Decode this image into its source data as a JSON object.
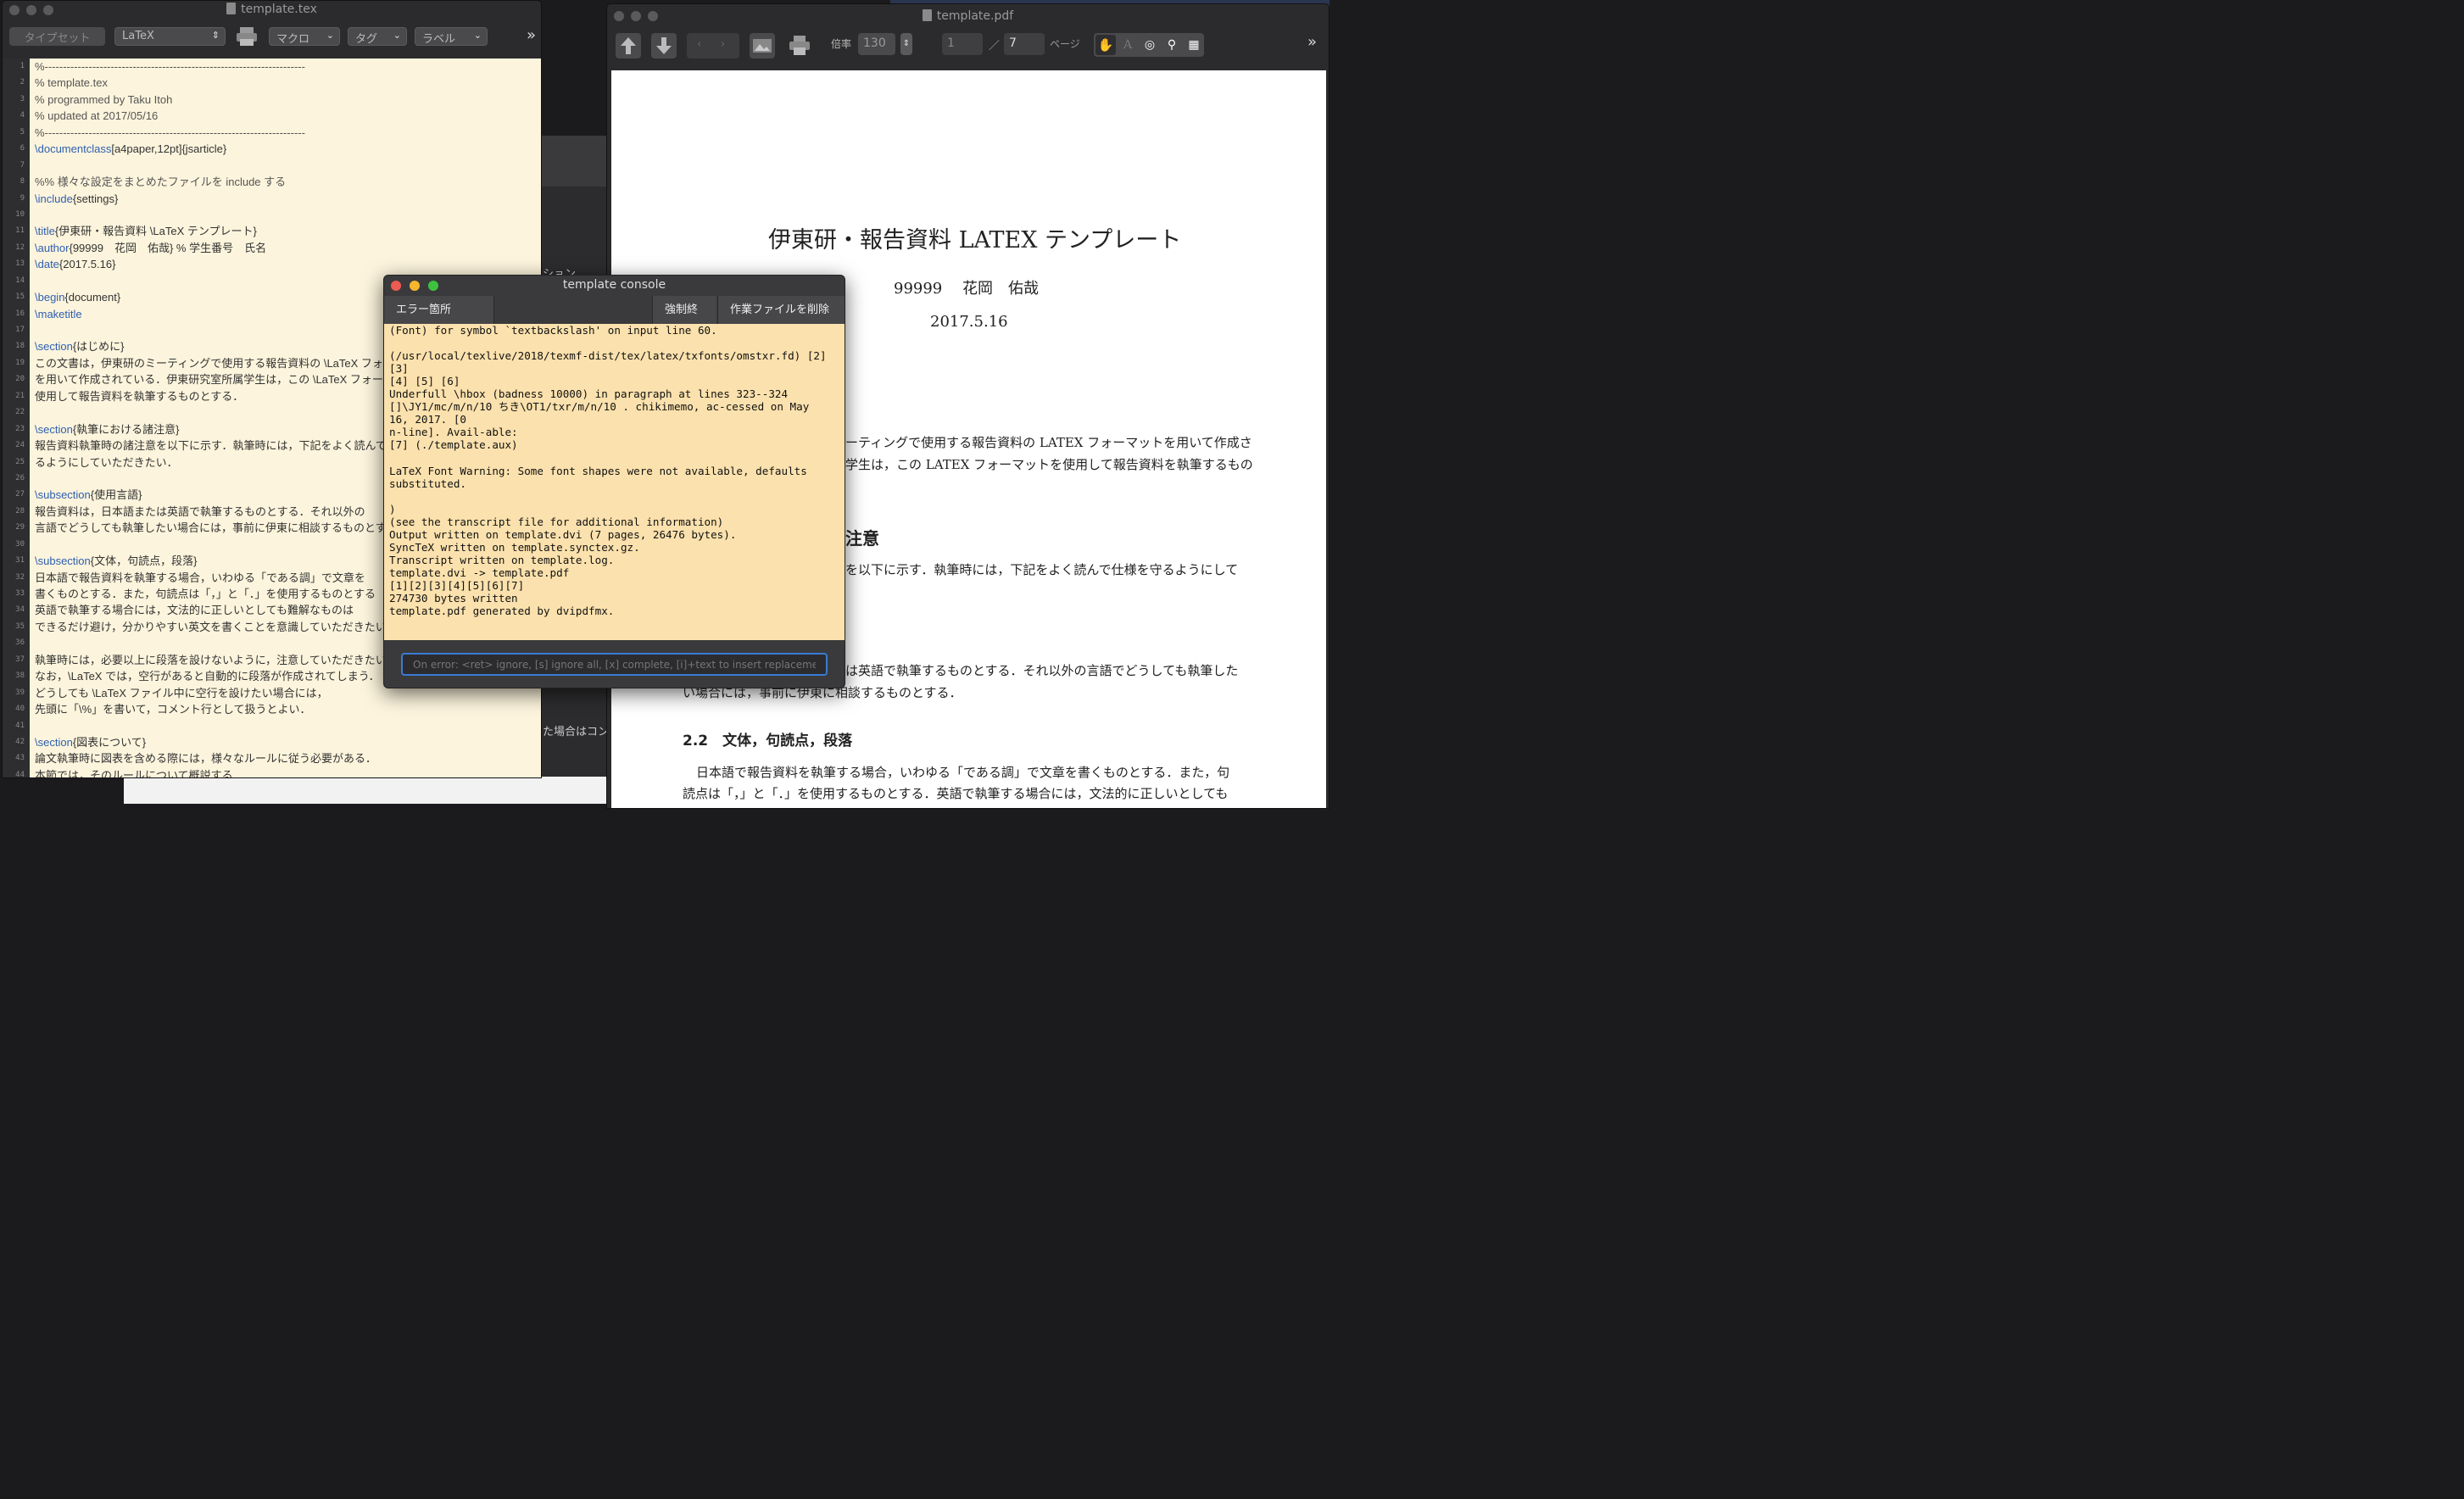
{
  "editor": {
    "title": "template.tex",
    "toolbar": {
      "typeset": "タイプセット",
      "engine": "LaTeX",
      "macro": "マクロ",
      "tag": "タグ",
      "label": "ラベル",
      "more": "»"
    },
    "lines": [
      {
        "n": "1",
        "t": "%-----------------------------------------------------------------------"
      },
      {
        "n": "2",
        "t": "%                 template.tex"
      },
      {
        "n": "3",
        "t": "%                 programmed  by Taku Itoh"
      },
      {
        "n": "4",
        "t": "%                 updated     at 2017/05/16"
      },
      {
        "n": "5",
        "t": "%-----------------------------------------------------------------------"
      },
      {
        "n": "6",
        "c": "\\documentclass",
        "t": "[a4paper,12pt]{jsarticle}"
      },
      {
        "n": "7",
        "t": ""
      },
      {
        "n": "8",
        "t": "%% 様々な設定をまとめたファイルを include する"
      },
      {
        "n": "9",
        "c": "\\include",
        "t": "{settings}"
      },
      {
        "n": "10",
        "t": ""
      },
      {
        "n": "11",
        "c": "\\title",
        "t": "{伊東研・報告資料 \\LaTeX テンプレート}"
      },
      {
        "n": "12",
        "c": "\\author",
        "t": "{99999　花岡　佑哉} % 学生番号　氏名"
      },
      {
        "n": "13",
        "c": "\\date",
        "t": "{2017.5.16}"
      },
      {
        "n": "14",
        "t": ""
      },
      {
        "n": "15",
        "c": "\\begin",
        "t": "{document}"
      },
      {
        "n": "16",
        "c": "\\maketitle",
        "t": ""
      },
      {
        "n": "17",
        "t": ""
      },
      {
        "n": "18",
        "c": "\\section",
        "t": "{はじめに}"
      },
      {
        "n": "19",
        "t": "この文書は，伊東研のミーティングで使用する報告資料の \\LaTeX フォ"
      },
      {
        "n": "20",
        "t": "を用いて作成されている．伊東研究室所属学生は，この \\LaTeX フォー"
      },
      {
        "n": "21",
        "t": "使用して報告資料を執筆するものとする．"
      },
      {
        "n": "22",
        "t": ""
      },
      {
        "n": "23",
        "c": "\\section",
        "t": "{執筆における諸注意}"
      },
      {
        "n": "24",
        "t": "報告資料執筆時の諸注意を以下に示す．執筆時には，下記をよく読んで"
      },
      {
        "n": "25",
        "t": "るようにしていただきたい．"
      },
      {
        "n": "26",
        "t": ""
      },
      {
        "n": "27",
        "c": "\\subsection",
        "t": "{使用言語}"
      },
      {
        "n": "28",
        "t": "報告資料は，日本語または英語で執筆するものとする．それ以外の"
      },
      {
        "n": "29",
        "t": "言語でどうしても執筆したい場合には，事前に伊東に相談するものとす"
      },
      {
        "n": "30",
        "t": ""
      },
      {
        "n": "31",
        "c": "\\subsection",
        "t": "{文体，句読点，段落}"
      },
      {
        "n": "32",
        "t": "日本語で報告資料を執筆する場合，いわゆる「である調」で文章を"
      },
      {
        "n": "33",
        "t": "書くものとする．また，句読点は「，」と「．」を使用するものとする"
      },
      {
        "n": "34",
        "t": "英語で執筆する場合には，文法的に正しいとしても難解なものは"
      },
      {
        "n": "35",
        "t": "できるだけ避け，分かりやすい英文を書くことを意識していただきたい"
      },
      {
        "n": "36",
        "t": ""
      },
      {
        "n": "37",
        "t": "執筆時には，必要以上に段落を設けないように，注意していただきたい"
      },
      {
        "n": "38",
        "t": "なお，\\LaTeX では，空行があると自動的に段落が作成されてしまう．"
      },
      {
        "n": "39",
        "t": "どうしても \\LaTeX ファイル中に空行を設けたい場合には，"
      },
      {
        "n": "40",
        "t": "先頭に「\\%」を書いて，コメント行として扱うとよい．"
      },
      {
        "n": "41",
        "t": ""
      },
      {
        "n": "42",
        "c": "\\section",
        "t": "{図表について}"
      },
      {
        "n": "43",
        "t": "論文執筆時に図表を含める際には，様々なルールに従う必要がある．"
      },
      {
        "n": "44",
        "t": "本節では，そのルールについて概説する．"
      }
    ]
  },
  "pdf": {
    "title": "template.pdf",
    "zoom_label": "倍率",
    "zoom": "130",
    "page_current": "1",
    "page_sep": "／",
    "page_total": "7",
    "page_label": "ページ",
    "more": "»",
    "doc": {
      "title": "伊東研・報告資料 LATEX テンプレート",
      "author": "99999　 花岡　佑哉",
      "date": "2017.5.16",
      "p1a": "ーティングで使用する報告資料の LATEX フォーマットを用いて作成さ",
      "p1b": "学生は，この LATEX フォーマットを使用して報告資料を執筆するもの",
      "h2": "注意",
      "p2": "を以下に示す．執筆時には，下記をよく読んで仕様を守るようにして",
      "p3a": "は英語で執筆するものとする．それ以外の言語でどうしても執筆した",
      "p3b": "い場合には，事前に伊東に相談するものとする．",
      "sub22": "2.2　文体，句読点，段落",
      "p4a": "日本語で報告資料を執筆する場合，いわゆる「である調」で文章を書くものとする．また，句",
      "p4b": "読点は「，」と「．」を使用するものとする．英語で執筆する場合には，文法的に正しいとしても"
    }
  },
  "console": {
    "title": "template console",
    "btn_error": "エラー箇所 ^⌘E",
    "btn_kill": "強制終了",
    "btn_delete": "作業ファイルを削除",
    "input_placeholder": "On error: <ret> ignore, [s] ignore all, [x] complete, [i]+text to insert replacement",
    "log": [
      "(Font)              for symbol `textbackslash' on input line 60.",
      "",
      "(/usr/local/texlive/2018/texmf-dist/tex/latex/txfonts/omstxr.fd) [2]",
      "[3]",
      "[4] [5] [6]",
      "Underfull \\hbox (badness 10000) in paragraph at lines 323--324",
      "[]\\JY1/mc/m/n/10 ちき\\OT1/txr/m/n/10 . chikimemo, ac-cessed on May",
      "16, 2017. [0",
      "n-line]. Avail-able:",
      "[7] (./template.aux)",
      "",
      "LaTeX Font Warning: Some font shapes were not available, defaults",
      "substituted.",
      "",
      " )",
      "(see the transcript file for additional information)",
      "Output written on template.dvi (7 pages, 26476 bytes).",
      "SyncTeX written on template.synctex.gz.",
      "Transcript written on template.log.",
      "template.dvi -> template.pdf",
      "[1][2][3][4][5][6][7]",
      "274730 bytes written",
      "template.pdf generated by dvipdfmx."
    ]
  },
  "background": {
    "mid_text1": "ション",
    "mid_text2": "た場合はコン"
  }
}
